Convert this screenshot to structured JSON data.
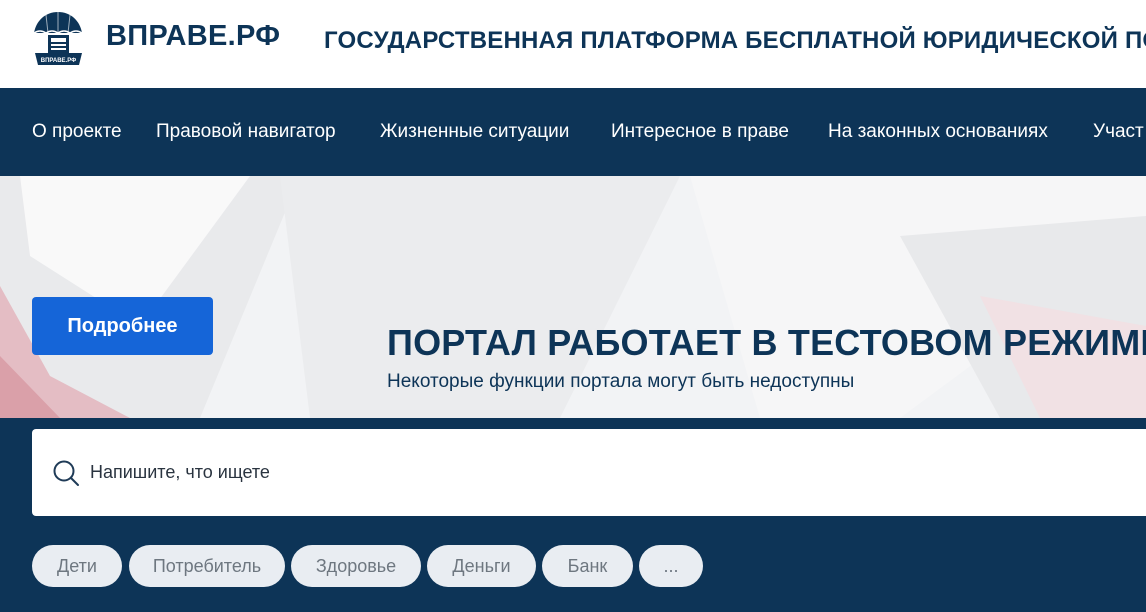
{
  "header": {
    "brand": "ВПРАВЕ.РФ",
    "tagline": "ГОСУДАРСТВЕННАЯ ПЛАТФОРМА БЕСПЛАТНОЙ ЮРИДИЧЕСКОЙ ПОМ",
    "logo_text": "ВПРАВЕ.РФ"
  },
  "nav": {
    "items": [
      {
        "label": "О проекте"
      },
      {
        "label": "Правовой навигатор"
      },
      {
        "label": "Жизненные ситуации"
      },
      {
        "label": "Интересное в праве"
      },
      {
        "label": "На законных основаниях"
      },
      {
        "label": "Участ"
      }
    ]
  },
  "banner": {
    "button_label": "Подробнее",
    "title": "ПОРТАЛ РАБОТАЕТ В ТЕСТОВОМ РЕЖИМЕ",
    "subtitle": "Некоторые функции портала могут быть недоступны"
  },
  "search": {
    "placeholder": "Напишите, что ищете",
    "icon": "search-icon"
  },
  "tags": [
    {
      "label": "Дети"
    },
    {
      "label": "Потребитель"
    },
    {
      "label": "Здоровье"
    },
    {
      "label": "Деньги"
    },
    {
      "label": "Банк"
    },
    {
      "label": "..."
    }
  ],
  "colors": {
    "navy": "#0d3457",
    "accent_blue": "#1565d8",
    "tag_bg": "#e9edf2"
  }
}
